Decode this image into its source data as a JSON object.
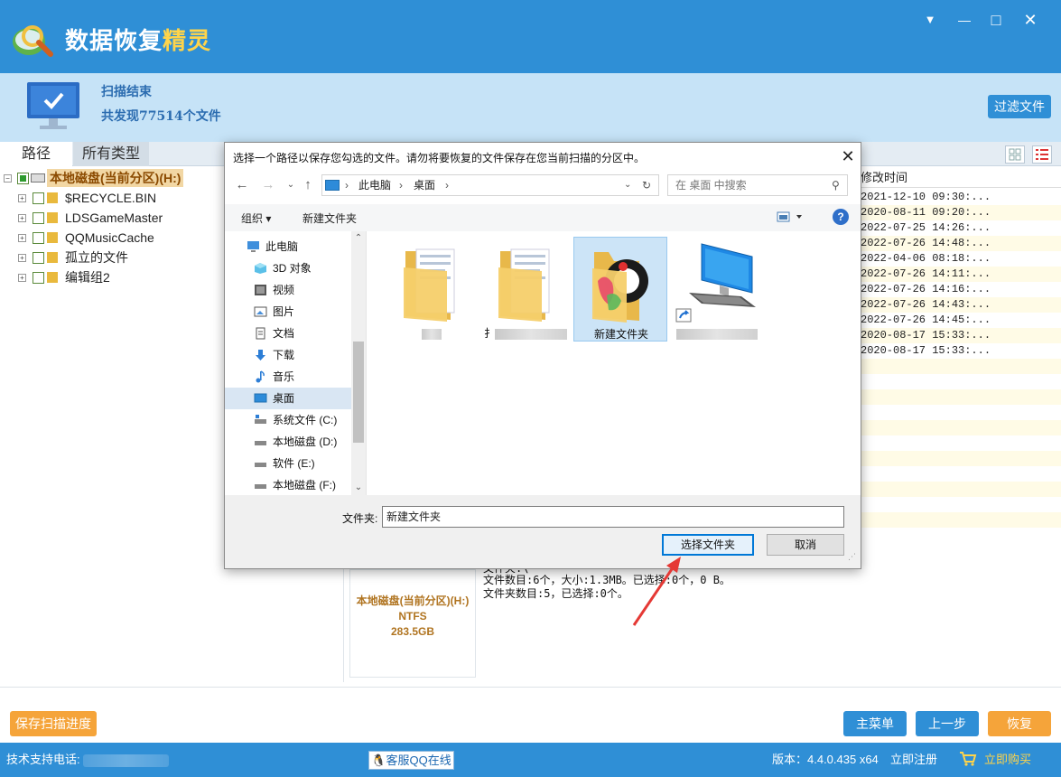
{
  "app": {
    "title_main": "数据恢复",
    "title_accent": "精灵",
    "window_controls": {
      "menu": "▼",
      "minimize": "—",
      "maximize": "□",
      "close": "✕"
    }
  },
  "status": {
    "title": "扫描结束",
    "count_text": "共发现77514个文件",
    "filter_button": "过滤文件"
  },
  "tabs": [
    {
      "label": "路径"
    },
    {
      "label": "所有类型"
    }
  ],
  "tree": {
    "root_label": "本地磁盘(当前分区)(H:)",
    "items": [
      {
        "label": "$RECYCLE.BIN"
      },
      {
        "label": "LDSGameMaster"
      },
      {
        "label": "QQMusicCache"
      },
      {
        "label": "孤立的文件"
      },
      {
        "label": "编辑组2"
      }
    ]
  },
  "file_list": {
    "column_header": "修改时间",
    "times": [
      "2021-12-10 09:30:...",
      "2020-08-11 09:20:...",
      "2022-07-25 14:26:...",
      "2022-07-26 14:48:...",
      "2022-04-06 08:18:...",
      "2022-07-26 14:11:...",
      "2022-07-26 14:16:...",
      "2022-07-26 14:43:...",
      "2022-07-26 14:45:...",
      "2020-08-17 15:33:...",
      "2020-08-17 15:33:..."
    ]
  },
  "info": {
    "disk_name": "本地磁盘(当前分区)(H:)",
    "fs": "NTFS",
    "size": "283.5GB",
    "line_partial": "文件夹:\\",
    "file_count_line": "文件数目:6个，大小:1.3MB。已选择:0个，0 B。",
    "folder_count_line": "文件夹数目:5，已选择:0个。"
  },
  "actions": {
    "save_progress": "保存扫描进度",
    "main_menu": "主菜单",
    "prev_step": "上一步",
    "recover": "恢复"
  },
  "footer": {
    "support_label": "技术支持电话:",
    "qq_label": "客服QQ在线",
    "version": "版本：4.4.0.435 x64",
    "register": "立即注册",
    "buy": "立即购买"
  },
  "dialog": {
    "title": "选择一个路径以保存您勾选的文件。请勿将要恢复的文件保存在您当前扫描的分区中。",
    "close": "✕",
    "breadcrumb": [
      "此电脑",
      "桌面"
    ],
    "search_placeholder": "在 桌面 中搜索",
    "toolbar": {
      "organize": "组织 ▾",
      "new_folder": "新建文件夹",
      "help": "?"
    },
    "nav_items": [
      {
        "label": "此电脑",
        "icon": "computer-icon"
      },
      {
        "label": "3D 对象",
        "icon": "cube-icon"
      },
      {
        "label": "视频",
        "icon": "video-icon"
      },
      {
        "label": "图片",
        "icon": "picture-icon"
      },
      {
        "label": "文档",
        "icon": "document-icon"
      },
      {
        "label": "下载",
        "icon": "download-icon"
      },
      {
        "label": "音乐",
        "icon": "music-icon"
      },
      {
        "label": "桌面",
        "icon": "desktop-icon"
      },
      {
        "label": "系统文件 (C:)",
        "icon": "drive-icon"
      },
      {
        "label": "本地磁盘 (D:)",
        "icon": "drive-icon"
      },
      {
        "label": "软件 (E:)",
        "icon": "drive-icon"
      },
      {
        "label": "本地磁盘 (F:)",
        "icon": "drive-icon"
      }
    ],
    "files": [
      {
        "label": ""
      },
      {
        "label": "扌"
      },
      {
        "label": "新建文件夹"
      },
      {
        "label": ""
      }
    ],
    "folder_label": "文件夹:",
    "folder_value": "新建文件夹",
    "select_button": "选择文件夹",
    "cancel_button": "取消"
  },
  "colors": {
    "brand_blue": "#2f8fd6",
    "accent_orange": "#f5a43a",
    "annotation_red": "#e53935"
  }
}
